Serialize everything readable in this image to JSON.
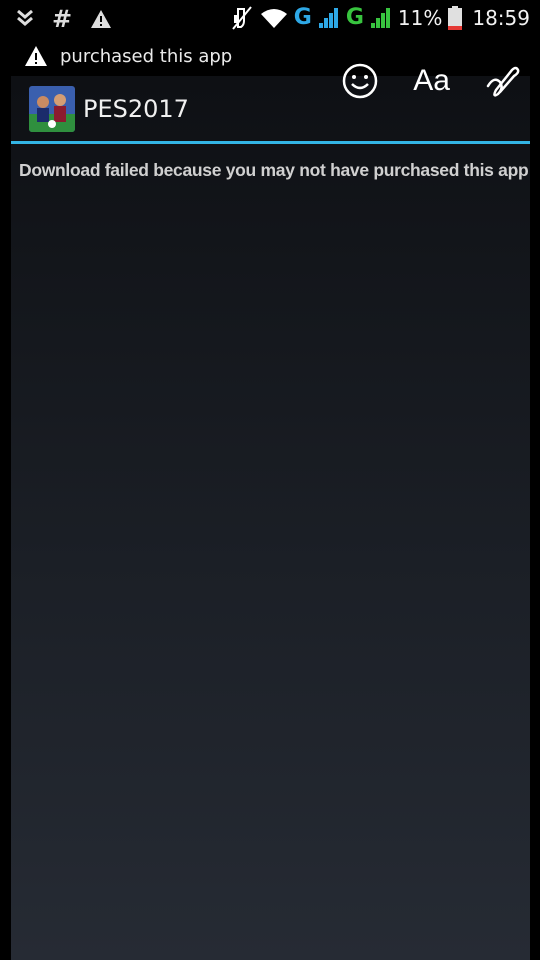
{
  "status_bar": {
    "left_icons": [
      "download-notification-icon",
      "hash-notification-icon",
      "warning-notification-icon"
    ],
    "hash_glyph": "#",
    "right_icons": [
      "mute-icon",
      "wifi-icon"
    ],
    "network_1": "G",
    "network_2": "G",
    "battery": "11%",
    "time": "18:59"
  },
  "ticker": {
    "text": "purchased this app"
  },
  "tools": {
    "emoji": "smiley-icon",
    "text_label": "Aa",
    "pen": "pen-icon"
  },
  "dialog": {
    "app_name": "PES2017",
    "message": "Download failed because you may not have purchased this app"
  },
  "colors": {
    "accent": "#33b5e5",
    "network_blue": "#2ea8e6",
    "network_green": "#38c43f",
    "battery_low": "#e53935"
  }
}
